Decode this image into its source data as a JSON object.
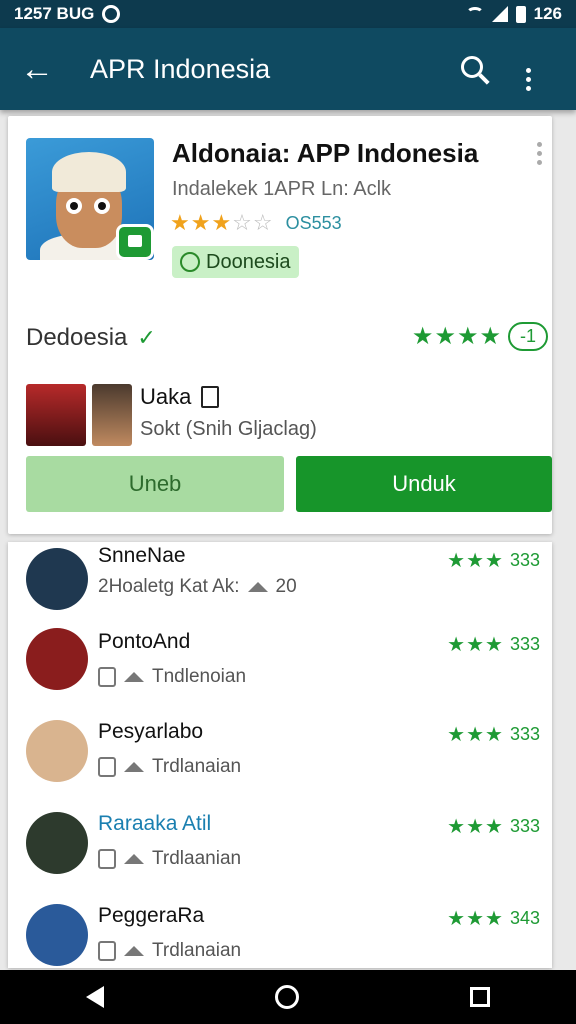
{
  "status_bar": {
    "time": "1257 BUG",
    "battery": "126"
  },
  "app_bar": {
    "title": "APR Indonesia"
  },
  "app_card": {
    "name": "Aldonaia: APP Indonesia",
    "developer": "Indalekek 1APR Ln: Aclk",
    "rating_stars": 2.5,
    "rating_count": "OS553",
    "tag": "Doonesia",
    "location": "Dedoesia",
    "score_pill": "-1",
    "friend_name": "Uaka",
    "friend_sub": "Sokt (Snih Gljaclag)",
    "button_secondary": "Uneb",
    "button_primary": "Unduk"
  },
  "list": [
    {
      "name": "SnneNae",
      "sub": "2Hoaletg Kat Ak:",
      "sub_count": "20",
      "score": "333",
      "color": "#1f3850",
      "link": false
    },
    {
      "name": "PontoAnd",
      "sub": "Tndlenoian",
      "sub_count": "",
      "score": "333",
      "color": "#8a1d1d",
      "link": false
    },
    {
      "name": "Pesyarlabo",
      "sub": "Trdlanaian",
      "sub_count": "",
      "score": "333",
      "color": "#d9b48f",
      "link": false
    },
    {
      "name": "Raraaka Atil",
      "sub": "Trdlaanian",
      "sub_count": "",
      "score": "333",
      "color": "#2d3a2d",
      "link": true
    },
    {
      "name": "PeggeraRa",
      "sub": "Trdlanaian",
      "sub_count": "",
      "score": "343",
      "color": "#2a5a9a",
      "link": false
    }
  ]
}
